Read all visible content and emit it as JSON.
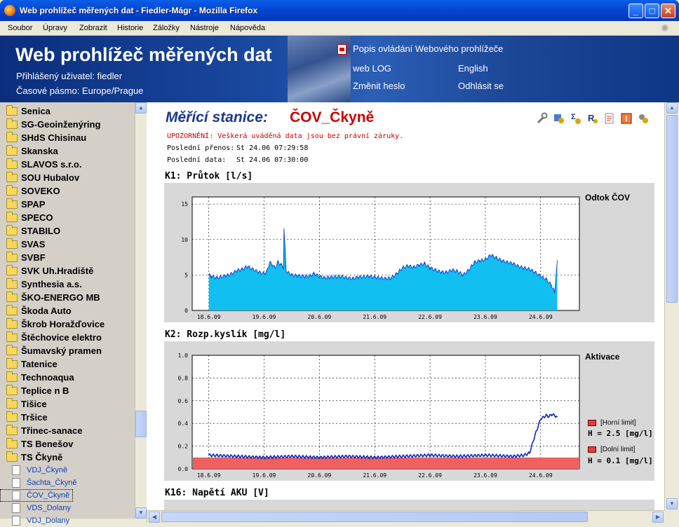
{
  "window": {
    "title": "Web prohlížeč měřených dat - Fiedler-Mágr - Mozilla Firefox"
  },
  "menu": [
    "Soubor",
    "Úpravy",
    "Zobrazit",
    "Historie",
    "Záložky",
    "Nástroje",
    "Nápověda"
  ],
  "header": {
    "title": "Web prohlížeč měřených dat",
    "user_label": "Přihlášený uživatel: fiedler",
    "timezone_label": "Časové pásmo: Europe/Prague",
    "help_link": "Popis ovládání Webového prohlížeče",
    "weblog": "web LOG",
    "english": "English",
    "change_password": "Změnit heslo",
    "logout": "Odhlásit se"
  },
  "sidebar": {
    "folders": [
      "Senica",
      "SG-Geoinženýring",
      "SHdS Chisinau",
      "Skanska",
      "SLAVOS s.r.o.",
      "SOU Hubalov",
      "SOVEKO",
      "SPAP",
      "SPECO",
      "STABILO",
      "SVAS",
      "SVBF",
      "SVK Uh.Hradiště",
      "Synthesia a.s.",
      "ŠKO-ENERGO MB",
      "Škoda Auto",
      "Škrob Horažďovice",
      "Štěchovice elektro",
      "Šumavský pramen",
      "Tatenice",
      "Technoaqua",
      "Teplice n B",
      "Tišice",
      "Tršice",
      "Třinec-sanace",
      "TS Benešov",
      "TS Čkyně"
    ],
    "stations": [
      "VDJ_Čkyně",
      "Šachta_Čkyně",
      "ČOV_Čkyně",
      "VDS_Dolany",
      "VDJ_Dolany"
    ]
  },
  "station": {
    "label": "Měřící stanice:",
    "name": "ČOV_Čkyně",
    "warning": "UPOZORNĚNÍ: Veškerá uváděná data jsou bez právní záruky.",
    "last_transfer_label": "Poslední přenos:",
    "last_transfer": "St 24.06 07:29:58",
    "last_data_label": "Poslední data:",
    "last_data": "St 24.06 07:30:00"
  },
  "colors": {
    "station_label": "#1a3a8c",
    "station_name": "#cc0000",
    "warning": "#cc0000",
    "flow_fill": "#11bff0",
    "flow_line": "#0a2cc0",
    "oxygen_line": "#0a2cc0",
    "limit_fill": "#f06060"
  },
  "chart_data": [
    {
      "type": "area",
      "section": "K1: Průtok [l/s]",
      "legend": "Odtok ČOV",
      "categories": [
        "18.6.09",
        "19.6.09",
        "20.6.09",
        "21.6.09",
        "22.6.09",
        "23.6.09",
        "24.6.09"
      ],
      "yticks": [
        "0",
        "5",
        "10",
        "15"
      ],
      "ylim": [
        0,
        16
      ],
      "x": [
        0,
        0.05,
        0.15,
        0.3,
        0.35,
        0.45,
        0.5,
        0.6,
        0.7,
        0.9,
        1,
        1.05,
        1.1,
        1.15,
        1.2,
        1.25,
        1.3,
        1.35,
        1.36,
        1.4,
        1.5,
        1.6,
        1.75,
        1.85,
        1.9,
        2,
        2.1,
        2.2,
        2.4,
        2.5,
        2.6,
        2.7,
        2.9,
        3,
        3.2,
        3.3,
        3.4,
        3.5,
        3.6,
        3.7,
        3.8,
        3.9,
        4,
        4.1,
        4.2,
        4.3,
        4.4,
        4.5,
        4.6,
        4.7,
        4.8,
        4.9,
        5,
        5.1,
        5.2,
        5.3,
        5.4,
        5.5,
        5.6,
        5.7,
        5.8,
        5.9,
        6,
        6.1,
        6.2,
        6.25,
        6.3
      ],
      "values": [
        5,
        4.8,
        4.6,
        4.9,
        5,
        5.3,
        5.6,
        5.8,
        6.2,
        5.4,
        5.2,
        5.5,
        6.8,
        6.4,
        6,
        6.8,
        6.5,
        6.1,
        11.5,
        5.5,
        5,
        4.9,
        4.8,
        4.9,
        5.2,
        4.8,
        4.6,
        4.7,
        4.8,
        4.6,
        4.5,
        4.7,
        4.8,
        4.7,
        4.5,
        4.6,
        5.2,
        6,
        6.3,
        6.1,
        6.4,
        6.6,
        6,
        5.7,
        5.4,
        5.4,
        5.7,
        5.5,
        5,
        5.7,
        6.8,
        7,
        7.2,
        7.8,
        7.4,
        7,
        6.8,
        6.6,
        6.2,
        6,
        5.8,
        5.4,
        4.8,
        4.4,
        3.5,
        2.5,
        7
      ]
    },
    {
      "type": "line",
      "section": "K2: Rozp.kyslík [mg/l]",
      "legend": "Aktivace",
      "categories": [
        "18.6.09",
        "19.6.09",
        "20.6.09",
        "21.6.09",
        "22.6.09",
        "23.6.09",
        "24.6.09"
      ],
      "yticks": [
        "0.0",
        "0.2",
        "0.4",
        "0.6",
        "0.8",
        "1.0"
      ],
      "ylim": [
        0,
        1
      ],
      "x": [
        0,
        0.5,
        1,
        1.5,
        2,
        2.5,
        3,
        3.5,
        4,
        4.5,
        5,
        5.5,
        5.7,
        5.8,
        5.9,
        6,
        6.1,
        6.15,
        6.2,
        6.3
      ],
      "values": [
        0.12,
        0.11,
        0.1,
        0.11,
        0.1,
        0.11,
        0.1,
        0.11,
        0.12,
        0.11,
        0.12,
        0.11,
        0.12,
        0.14,
        0.3,
        0.44,
        0.47,
        0.46,
        0.48,
        0.46
      ],
      "limits": [
        {
          "label": "[Horní limit]",
          "value_label": "H = 2.5 [mg/l]"
        },
        {
          "label": "[Dolní limit]",
          "value_label": "H = 0.1 [mg/l]"
        }
      ]
    },
    {
      "type": "line",
      "section": "K16: Napětí AKU [V]"
    }
  ]
}
